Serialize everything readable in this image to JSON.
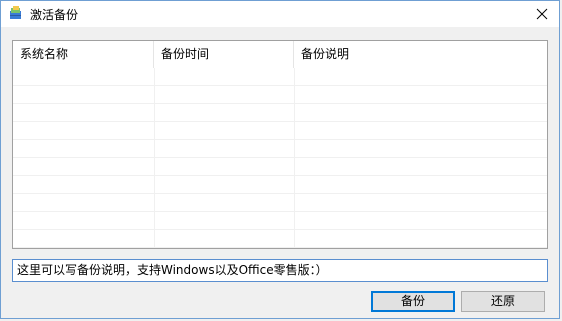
{
  "window": {
    "title": "激活备份",
    "icon": "app-icon"
  },
  "list": {
    "columns": [
      "系统名称",
      "备份时间",
      "备份说明"
    ],
    "rows": []
  },
  "note": {
    "value": "这里可以写备份说明，支持Windows以及Office零售版：）"
  },
  "buttons": {
    "backup_label": "备份",
    "restore_label": "还原"
  },
  "colors": {
    "accent": "#0078d7",
    "border": "#a0a0a0",
    "background": "#f0f0f0"
  }
}
